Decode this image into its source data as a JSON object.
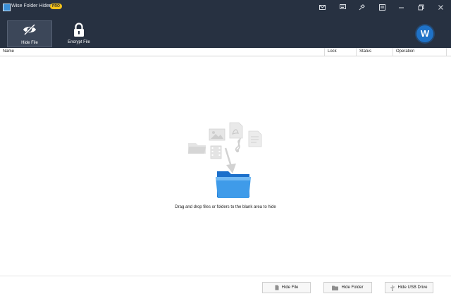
{
  "window": {
    "title": "Wise Folder Hider",
    "badge": "PRO",
    "controls": [
      "mail-icon",
      "feedback-icon",
      "skin-icon",
      "menu-icon",
      "minimize-icon",
      "restore-icon",
      "close-icon"
    ]
  },
  "toolbar": {
    "tabs": [
      {
        "label": "Hide File",
        "icon": "eye-slash-icon",
        "active": true
      },
      {
        "label": "Encrypt File",
        "icon": "lock-icon",
        "active": false
      }
    ],
    "avatar_letter": "W"
  },
  "table": {
    "columns": [
      "Name",
      "Lock",
      "Status",
      "Operation"
    ]
  },
  "drop_area": {
    "hint": "Drag and drop files or folders to the blank area to hide",
    "icons": [
      "folder-icon",
      "image-icon",
      "film-icon",
      "pdf-icon",
      "music-icon",
      "document-icon",
      "arrow-down-icon",
      "blue-folder-icon"
    ]
  },
  "footer": {
    "hide_file_label": "Hide File",
    "hide_folder_label": "Hide Folder",
    "hide_usb_label": "Hide USB Drive"
  },
  "colors": {
    "titlebar_bg": "#273141",
    "active_tab_bg": "#3c4759",
    "accent_blue": "#1f72c7",
    "pro_badge": "#f4c21b"
  }
}
